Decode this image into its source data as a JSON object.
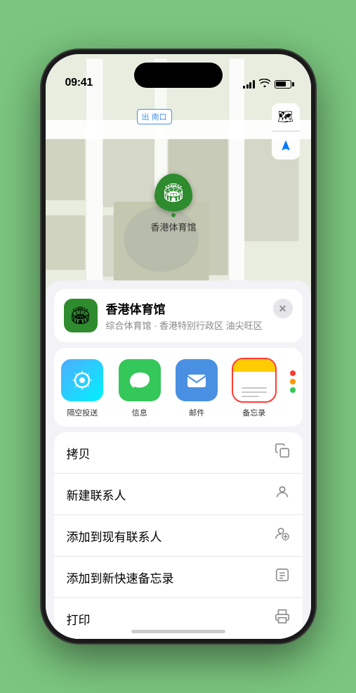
{
  "status_bar": {
    "time": "09:41",
    "location_arrow": "▶"
  },
  "map": {
    "label_text": "南口",
    "label_prefix": "出"
  },
  "venue": {
    "name": "香港体育馆",
    "subtitle": "综合体育馆 · 香港特别行政区 油尖旺区",
    "logo_emoji": "🏟️",
    "marker_emoji": "🏟️"
  },
  "share_actions": [
    {
      "id": "airdrop",
      "label": "隔空投送",
      "type": "airdrop"
    },
    {
      "id": "message",
      "label": "信息",
      "type": "message"
    },
    {
      "id": "mail",
      "label": "邮件",
      "type": "mail"
    },
    {
      "id": "notes",
      "label": "备忘录",
      "type": "notes",
      "selected": true
    }
  ],
  "action_items": [
    {
      "id": "copy",
      "label": "拷贝",
      "icon": "⎘"
    },
    {
      "id": "new-contact",
      "label": "新建联系人",
      "icon": "👤"
    },
    {
      "id": "add-existing",
      "label": "添加到现有联系人",
      "icon": "👤"
    },
    {
      "id": "quick-note",
      "label": "添加到新快速备忘录",
      "icon": "⊞"
    },
    {
      "id": "print",
      "label": "打印",
      "icon": "🖨"
    }
  ],
  "dots": [
    {
      "color": "#ff3b30"
    },
    {
      "color": "#ff9500"
    },
    {
      "color": "#34c759"
    }
  ],
  "buttons": {
    "close": "✕",
    "map_type": "🗺",
    "location": "➤"
  }
}
